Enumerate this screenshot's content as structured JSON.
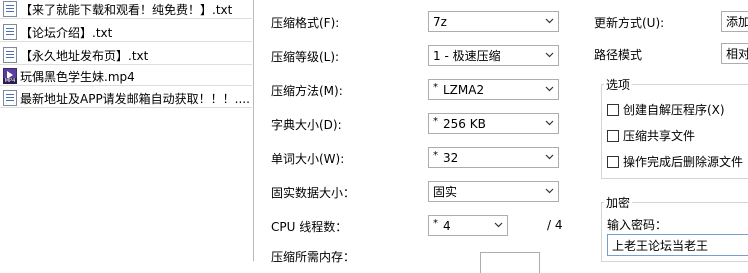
{
  "files": [
    {
      "name": "【来了就能下载和观看！纯免费！】.txt",
      "icon": "txt-file-icon"
    },
    {
      "name": "【论坛介绍】.txt",
      "icon": "txt-file-icon"
    },
    {
      "name": "【永久地址发布页】.txt",
      "icon": "txt-file-icon"
    },
    {
      "name": "玩偶黑色学生妹.mp4",
      "icon": "mp4-file-icon"
    },
    {
      "name": "最新地址及APP请发邮箱自动获取！！！....",
      "icon": "txt-file-icon"
    }
  ],
  "settings": {
    "format": {
      "label": "压缩格式(F):",
      "value": "7z"
    },
    "level": {
      "label": "压缩等级(L):",
      "value": "1 - 极速压缩"
    },
    "method": {
      "label": "压缩方法(M):",
      "value": "LZMA2"
    },
    "dict": {
      "label": "字典大小(D):",
      "value": "256 KB"
    },
    "word": {
      "label": "单词大小(W):",
      "value": "32"
    },
    "solid": {
      "label": "固实数据大小：",
      "value": "固实"
    },
    "cpu": {
      "label": "CPU 线程数：",
      "value": "4",
      "total": "/ 4"
    },
    "memory": {
      "label": "压缩所需内存："
    }
  },
  "right": {
    "update_label": "更新方式(U):",
    "update_value": "添加",
    "path_label": "路径模式",
    "path_value": "相对",
    "options": {
      "title": "选项",
      "sfx": "创建自解压程序(X)",
      "shared": "压缩共享文件",
      "delete": "操作完成后删除源文件"
    },
    "encryption": {
      "title": "加密",
      "password_label": "输入密码：",
      "password_value": "上老王论坛当老王"
    }
  }
}
